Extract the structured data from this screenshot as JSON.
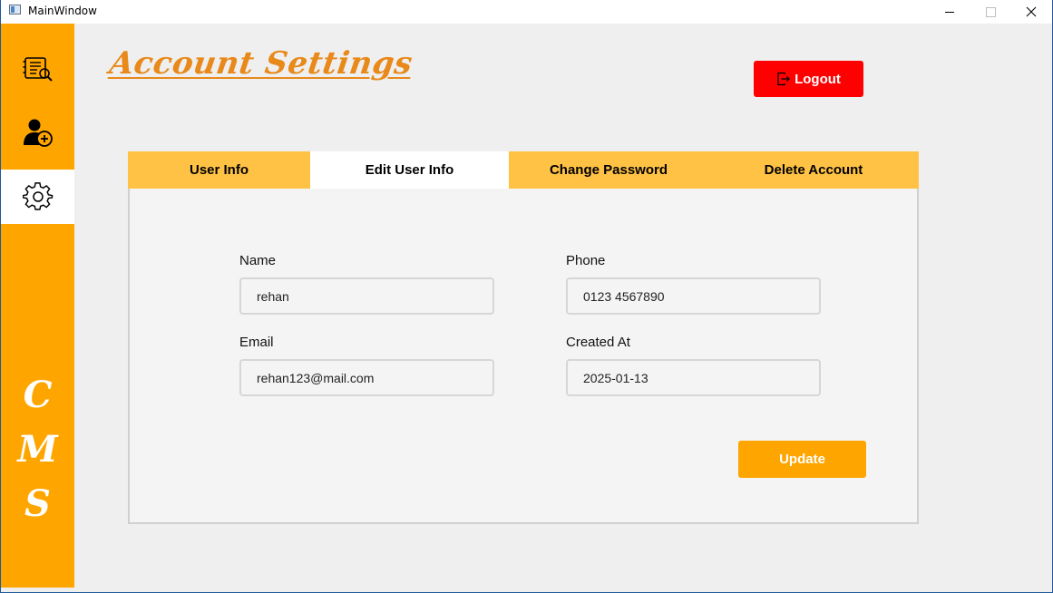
{
  "window": {
    "title": "MainWindow"
  },
  "sidebar": {
    "items": [
      {
        "icon": "directory-book-icon",
        "active": false
      },
      {
        "icon": "add-user-icon",
        "active": false
      },
      {
        "icon": "gear-icon",
        "active": true
      }
    ],
    "brand_letters": [
      "C",
      "M",
      "S"
    ]
  },
  "header": {
    "title": "Account Settings",
    "logout_label": "Logout"
  },
  "tabs": [
    {
      "label": "User Info",
      "active": false
    },
    {
      "label": "Edit User Info",
      "active": true
    },
    {
      "label": "Change Password",
      "active": false
    },
    {
      "label": "Delete Account",
      "active": false
    }
  ],
  "form": {
    "name": {
      "label": "Name",
      "value": "rehan"
    },
    "phone": {
      "label": "Phone",
      "value": "0123 4567890"
    },
    "email": {
      "label": "Email",
      "value": "rehan123@mail.com"
    },
    "created_at": {
      "label": "Created At",
      "value": "2025-01-13"
    },
    "update_label": "Update"
  },
  "colors": {
    "sidebar": "#ffa500",
    "title": "#e8891a",
    "logout": "#ff0000",
    "tab_bar": "#ffc244",
    "update": "#ffa500"
  }
}
